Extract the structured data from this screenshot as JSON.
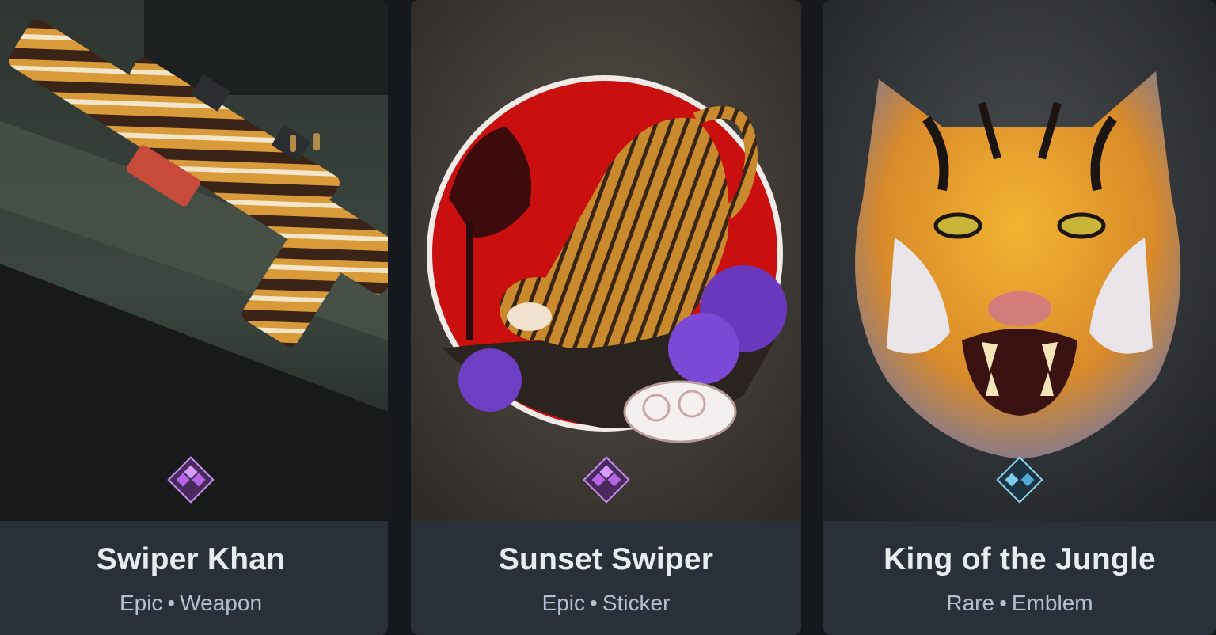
{
  "cards": [
    {
      "name": "Swiper Khan",
      "rarity": "Epic",
      "separator": "•",
      "type": "Weapon",
      "rarity_color": "#a451d6",
      "rarity_icon": "epic-rarity-icon"
    },
    {
      "name": "Sunset Swiper",
      "rarity": "Epic",
      "separator": "•",
      "type": "Sticker",
      "rarity_color": "#a451d6",
      "rarity_icon": "epic-rarity-icon"
    },
    {
      "name": "King of the Jungle",
      "rarity": "Rare",
      "separator": "•",
      "type": "Emblem",
      "rarity_color": "#4fb0d8",
      "rarity_icon": "rare-rarity-icon"
    }
  ],
  "colors": {
    "card_bg": "#29303a",
    "title": "#e9ecef",
    "meta": "#b3c0d2",
    "epic": "#a451d6",
    "rare": "#4fb0d8"
  }
}
